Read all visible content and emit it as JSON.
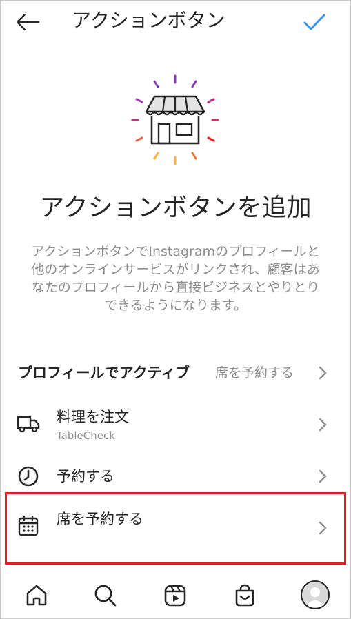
{
  "header": {
    "title": "アクションボタン",
    "back_icon": "arrow-left-icon",
    "done_icon": "checkmark-icon"
  },
  "hero": {
    "icon": "storefront-icon",
    "title": "アクションボタンを追加",
    "description": "アクションボタンでInstagramのプロフィールと他のオンラインサービスがリンクされ、顧客はあなたのプロフィールから直接ビジネスとやりとりできるようになります。"
  },
  "active_row": {
    "label": "プロフィールでアクティブ",
    "value": "席を予約する"
  },
  "options": [
    {
      "icon": "delivery-truck-icon",
      "label": "料理を注文",
      "sub": "TableCheck"
    },
    {
      "icon": "clock-icon",
      "label": "予約する"
    },
    {
      "icon": "calendar-icon",
      "label": "席を予約する"
    }
  ],
  "bottom_nav": [
    "home-icon",
    "search-icon",
    "reels-icon",
    "shop-icon",
    "profile-avatar"
  ],
  "colors": {
    "accent": "#3897f0",
    "text": "#262626",
    "secondary": "#8e8e8e",
    "highlight": "#e01c24"
  }
}
